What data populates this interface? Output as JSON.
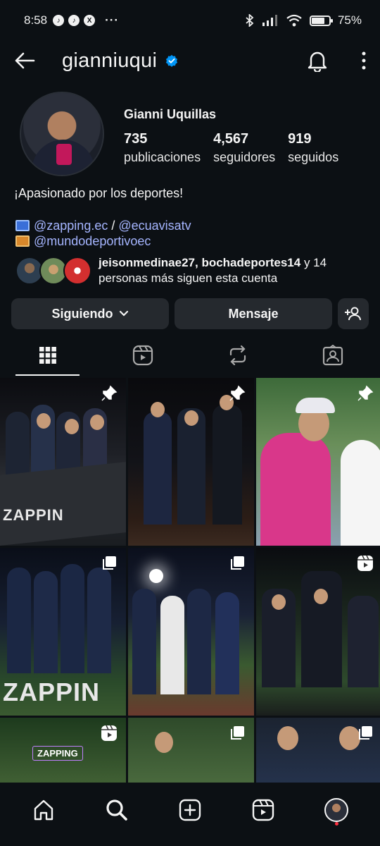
{
  "status": {
    "time": "8:58",
    "battery": "75%",
    "battery_level": 0.75
  },
  "header": {
    "username": "gianniuqui"
  },
  "profile": {
    "name": "Gianni Uquillas",
    "stats": [
      {
        "value": "735",
        "label": "publicaciones"
      },
      {
        "value": "4,567",
        "label": "seguidores"
      },
      {
        "value": "919",
        "label": "seguidos"
      }
    ],
    "bio": "¡Apasionado por los deportes!",
    "link1": "@zapping.ec",
    "sep": " / ",
    "link2": "@ecuavisatv",
    "link3": "@mundodeportivoec",
    "followed_by": {
      "names": "jeisonmedinae27, bochadeportes14",
      "rest1": " y 14",
      "rest2": "personas más siguen esta cuenta"
    }
  },
  "actions": {
    "following": "Siguiendo",
    "message": "Mensaje"
  },
  "grid": {
    "texts": {
      "c1": "ZAPPIN",
      "c7": "ZAPPIN",
      "c10": "ZAPPING"
    }
  },
  "colors": {
    "background": "#0c1014",
    "button": "#25292e",
    "link": "#a5b5ff",
    "verified": "#0095f6",
    "notify": "#ff3040"
  }
}
